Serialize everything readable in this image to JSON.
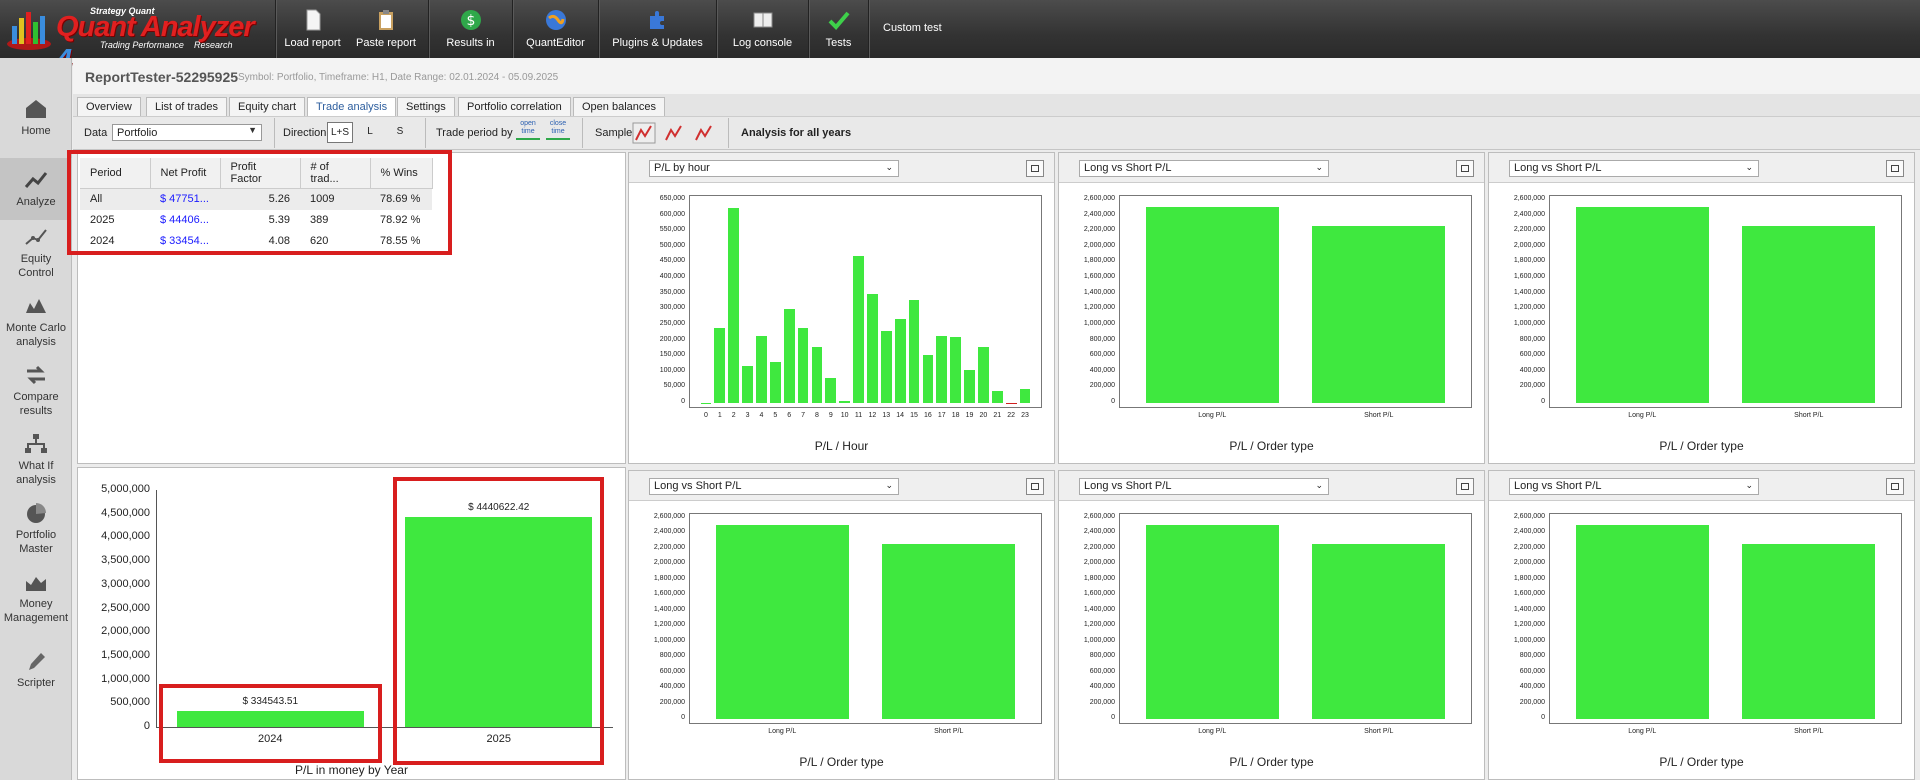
{
  "app": {
    "brand_top": "Strategy Quant",
    "brand_name": "Quant Analyzer",
    "brand_version": "4",
    "brand_left": "Trading Performance",
    "brand_right": "Research"
  },
  "toolbar": {
    "load_report": "Load report",
    "paste_report": "Paste report",
    "results_in": "Results in",
    "quanteditor": "QuantEditor",
    "plugins": "Plugins & Updates",
    "log_console": "Log console",
    "tests": "Tests",
    "custom_test": "Custom test"
  },
  "nav": {
    "home": "Home",
    "analyze": "Analyze",
    "equity1": "Equity",
    "equity2": "Control",
    "monte1": "Monte Carlo",
    "monte2": "analysis",
    "compare1": "Compare",
    "compare2": "results",
    "whatif1": "What If",
    "whatif2": "analysis",
    "portfolio1": "Portfolio",
    "portfolio2": "Master",
    "money1": "Money",
    "money2": "Management",
    "scripter": "Scripter"
  },
  "report": {
    "title": "ReportTester-52295925",
    "subtitle": "Symbol: Portfolio, Timeframe: H1, Date Range: 02.01.2024 - 05.09.2025"
  },
  "tabs": [
    "Overview",
    "List of trades",
    "Equity chart",
    "Trade analysis",
    "Settings",
    "Portfolio correlation",
    "Open balances"
  ],
  "filters": {
    "data_label": "Data",
    "data_value": "Portfolio",
    "direction_label": "Direction",
    "dir_ls": "L+S",
    "dir_l": "L",
    "dir_s": "S",
    "period_label": "Trade period by",
    "open_time": "open time",
    "close_time": "close time",
    "sample_label": "Sample",
    "heading": "Analysis for all years"
  },
  "period_table": {
    "headers": [
      "Period",
      "Net Profit",
      "Profit Factor",
      "# of trad...",
      "% Wins"
    ],
    "rows": [
      [
        "All",
        "$ 47751...",
        "5.26",
        "1009",
        "78.69 %"
      ],
      [
        "2025",
        "$ 44406...",
        "5.39",
        "389",
        "78.92 %"
      ],
      [
        "2024",
        "$ 33454...",
        "4.08",
        "620",
        "78.55 %"
      ]
    ]
  },
  "panels": {
    "hour_select": "P/L by hour",
    "lvs_select": "Long vs Short P/L",
    "hour_xlabel": "P/L / Hour",
    "ot_xlabel": "P/L / Order type",
    "long_label": "Long P/L",
    "short_label": "Short P/L"
  },
  "chart_data": [
    {
      "type": "bar",
      "xlabel": "P/L / Hour",
      "categories": [
        "0",
        "1",
        "2",
        "3",
        "4",
        "5",
        "6",
        "7",
        "8",
        "9",
        "10",
        "11",
        "12",
        "13",
        "14",
        "15",
        "16",
        "17",
        "18",
        "19",
        "20",
        "21",
        "22",
        "23"
      ],
      "values": [
        0,
        240000,
        625000,
        120000,
        215000,
        130000,
        300000,
        240000,
        180000,
        80000,
        5000,
        470000,
        350000,
        230000,
        270000,
        330000,
        155000,
        215000,
        210000,
        105000,
        180000,
        40000,
        -3000,
        45000
      ],
      "yticks": [
        "650,000",
        "600,000",
        "550,000",
        "500,000",
        "450,000",
        "400,000",
        "350,000",
        "300,000",
        "250,000",
        "200,000",
        "150,000",
        "100,000",
        "50,000",
        "0"
      ],
      "ylim": [
        0,
        650000
      ]
    },
    {
      "type": "bar",
      "xlabel": "P/L / Order type",
      "categories": [
        "Long P/L",
        "Short P/L"
      ],
      "values": [
        2510000,
        2270000
      ],
      "yticks": [
        "2,600,000",
        "2,400,000",
        "2,200,000",
        "2,000,000",
        "1,800,000",
        "1,600,000",
        "1,400,000",
        "1,200,000",
        "1,000,000",
        "800,000",
        "600,000",
        "400,000",
        "200,000",
        "0"
      ],
      "ylim": [
        0,
        2600000
      ]
    },
    {
      "type": "bar",
      "xlabel": "P/L in money by Year",
      "categories": [
        "2024",
        "2025"
      ],
      "values": [
        334543.51,
        4440622.42
      ],
      "value_labels": [
        "$ 334543.51",
        "$ 4440622.42"
      ],
      "yticks": [
        "5,000,000",
        "4,500,000",
        "4,000,000",
        "3,500,000",
        "3,000,000",
        "2,500,000",
        "2,000,000",
        "1,500,000",
        "1,000,000",
        "500,000",
        "0"
      ],
      "ylim": [
        0,
        5000000
      ]
    }
  ]
}
